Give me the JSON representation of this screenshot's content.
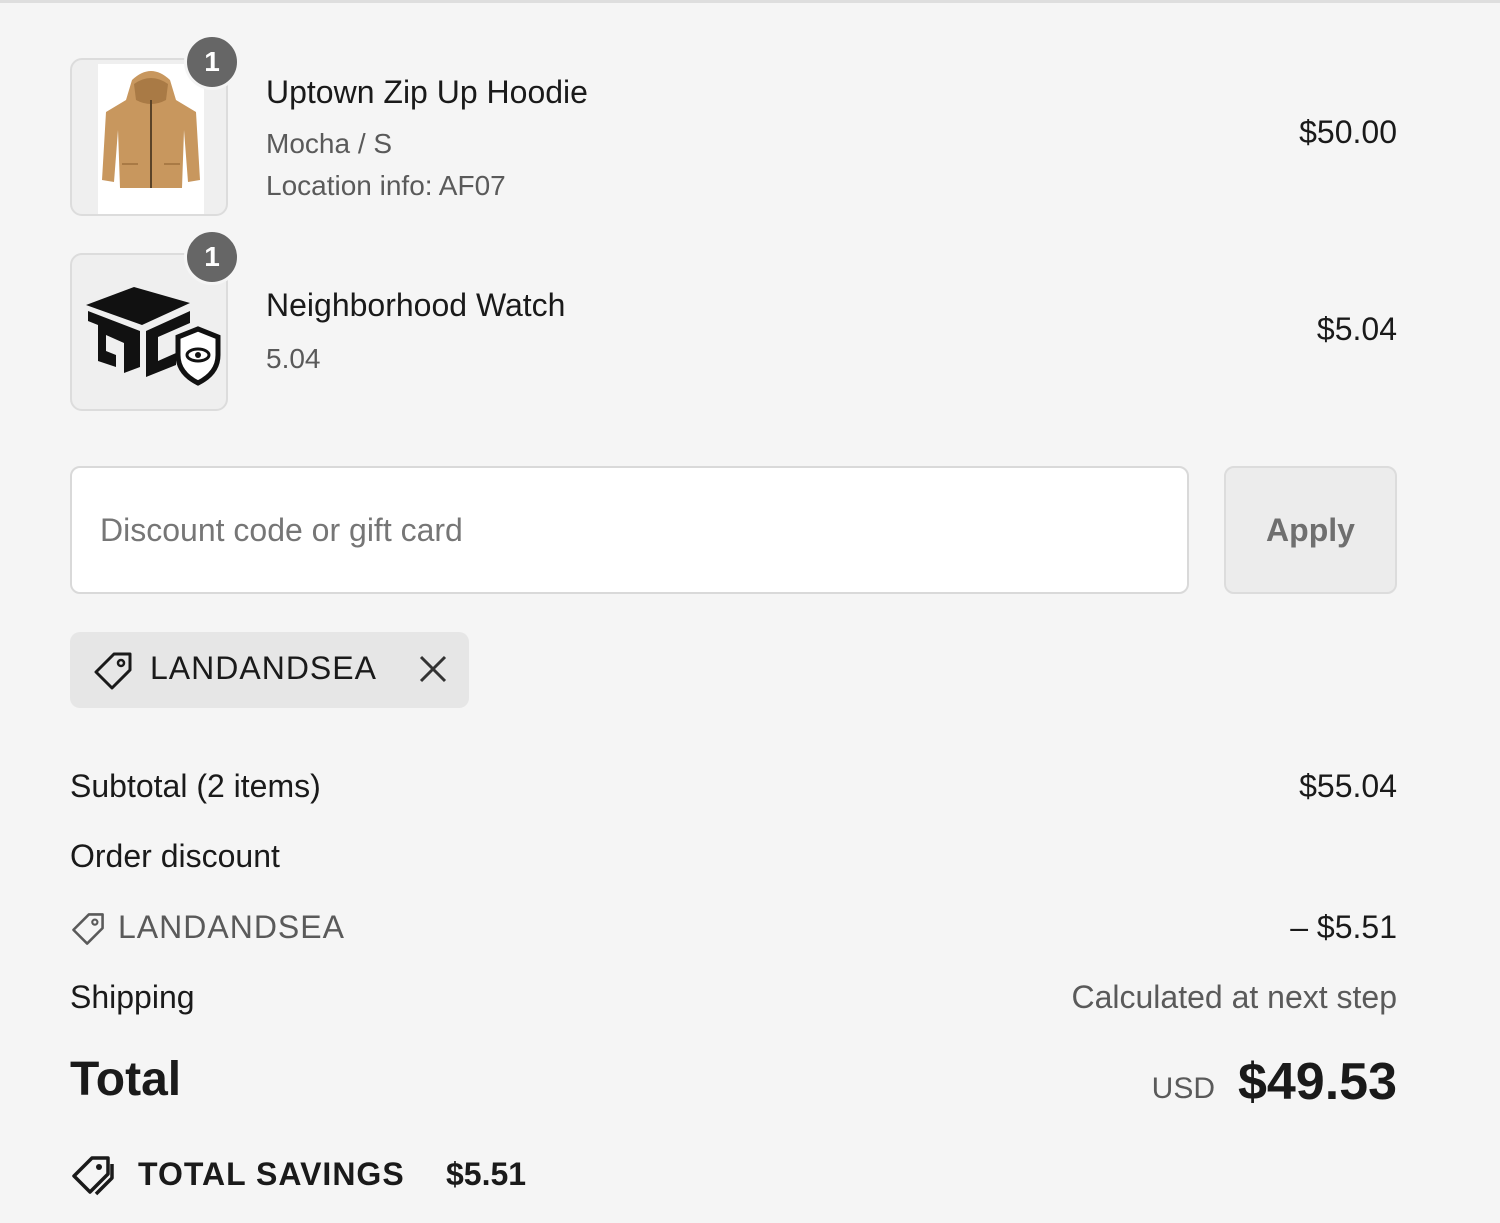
{
  "line_items": [
    {
      "name": "Uptown Zip Up Hoodie",
      "variant": "Mocha / S",
      "location": "Location info: AF07",
      "price": "$50.00",
      "quantity": "1",
      "thumbnail_icon": "hoodie-image",
      "hoodie_color": "#c8975e"
    },
    {
      "name": "Neighborhood Watch",
      "variant": "5.04",
      "price": "$5.04",
      "quantity": "1",
      "thumbnail_icon": "neighborhood-watch-logo"
    }
  ],
  "discount": {
    "placeholder": "Discount code or gift card",
    "value": "",
    "apply_label": "Apply",
    "applied_code": "LANDANDSEA"
  },
  "summary": {
    "subtotal_label": "Subtotal (2 items)",
    "subtotal_value": "$55.04",
    "order_discount_label": "Order discount",
    "discount_code": "LANDANDSEA",
    "discount_value": "– $5.51",
    "shipping_label": "Shipping",
    "shipping_value": "Calculated at next step",
    "total_label": "Total",
    "currency": "USD",
    "total_value": "$49.53",
    "savings_label": "TOTAL SAVINGS",
    "savings_value": "$5.51"
  }
}
